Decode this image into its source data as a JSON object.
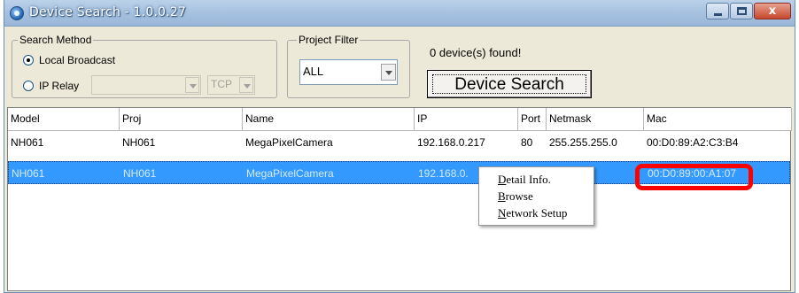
{
  "window": {
    "title": "Device Search - 1.0.0.27",
    "controls": {
      "minimize": "minimize",
      "maximize": "maximize",
      "close": "x"
    }
  },
  "search_method": {
    "legend": "Search Method",
    "options": [
      {
        "label": "Local Broadcast",
        "checked": true
      },
      {
        "label": "IP Relay",
        "checked": false
      }
    ],
    "ip_relay_value": "",
    "protocol_value": "TCP"
  },
  "project_filter": {
    "legend": "Project Filter",
    "selected": "ALL"
  },
  "status": {
    "found_text": "0 device(s) found!"
  },
  "device_search_button": {
    "label": "Device Search"
  },
  "table": {
    "columns": [
      "Model",
      "Proj",
      "Name",
      "IP",
      "Port",
      "Netmask",
      "Mac"
    ],
    "rows": [
      {
        "model": "NH061",
        "proj": "NH061",
        "name": "MegaPixelCamera",
        "ip": "192.168.0.217",
        "port": "80",
        "netmask": "255.255.255.0",
        "mac": "00:D0:89:A2:C3:B4",
        "selected": false
      },
      {
        "model": "NH061",
        "proj": "NH061",
        "name": "MegaPixelCamera",
        "ip": "192.168.0.",
        "port": "",
        "netmask": "5.25  0",
        "mac": "00:D0:89:00:A1:07",
        "selected": true
      }
    ]
  },
  "context_menu": {
    "items": [
      {
        "first": "D",
        "rest": "etail Info."
      },
      {
        "first": "B",
        "rest": "rowse"
      },
      {
        "first": "N",
        "rest": "etwork Setup"
      }
    ]
  },
  "annotation": {
    "color": "#ff0000"
  },
  "colors": {
    "selection": "#3399ff",
    "titlebar": "#a8c2e0",
    "window_bg": "#ece9d8"
  }
}
